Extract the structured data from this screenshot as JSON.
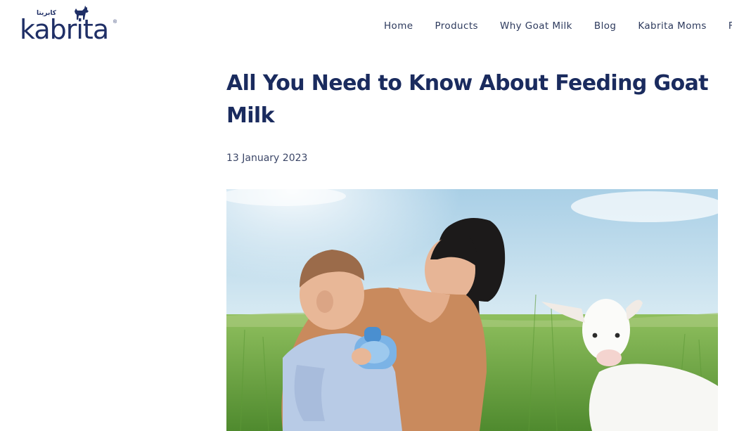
{
  "header": {
    "logo_text": "kabrita",
    "logo_arabic": "كابريتا",
    "logo_reg": "®",
    "nav": [
      {
        "label": "Home"
      },
      {
        "label": "Products"
      },
      {
        "label": "Why Goat Milk"
      },
      {
        "label": "Blog"
      },
      {
        "label": "Kabrita Moms"
      },
      {
        "label": "FA"
      }
    ]
  },
  "article": {
    "title": "All You Need to Know About Feeding Goat Milk",
    "date": "13 January 2023"
  },
  "colors": {
    "brand_navy": "#1a2b5e",
    "nav_text": "#2d3a5d"
  }
}
